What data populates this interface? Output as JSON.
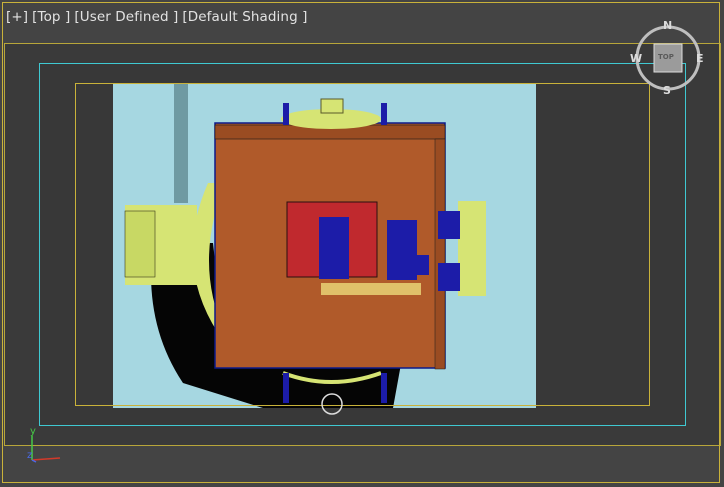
{
  "viewport": {
    "labels": {
      "plus": "[+]",
      "view": "[Top ]",
      "mode": "[User Defined ]",
      "shading": "[Default Shading ]"
    }
  },
  "viewcube": {
    "north": "N",
    "south": "S",
    "east": "E",
    "west": "W",
    "face": "TOP"
  },
  "axis": {
    "y": "y",
    "z": "z",
    "x_color": "#d23a2a",
    "y_color": "#46c846",
    "z_color": "#4a6ae8"
  },
  "colors": {
    "background": "#444444",
    "sky": "#a6d7e1",
    "body": "#b05a2a",
    "panel_red": "#c0292e",
    "motor_blue": "#1c1ca8",
    "yellow_green": "#d6e474",
    "frame_cyan": "#3fc9d2",
    "frame_yellow": "#c9b23a"
  }
}
